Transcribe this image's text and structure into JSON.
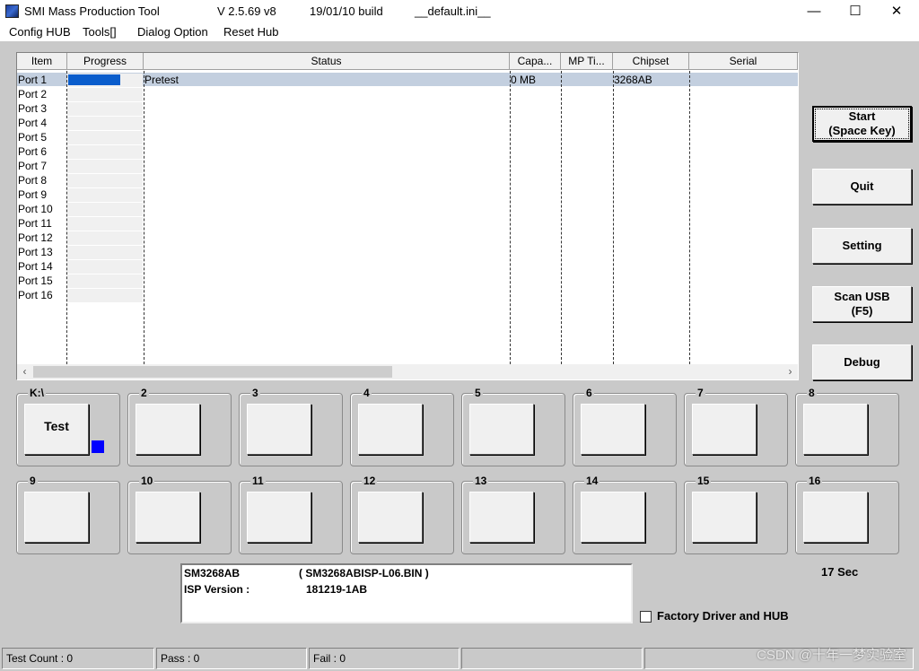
{
  "window": {
    "title": "SMI Mass Production Tool",
    "version": "V 2.5.69   v8",
    "build": "19/01/10 build",
    "ini": "__default.ini__",
    "controls": {
      "minimize": "—",
      "maximize": "☐",
      "close": "✕"
    }
  },
  "menu": [
    "Config HUB",
    "Tools[]",
    "Dialog Option",
    "Reset Hub"
  ],
  "grid": {
    "columns": [
      "Item",
      "Progress",
      "Status",
      "Capa...",
      "MP Ti...",
      "Chipset",
      "Serial"
    ],
    "rows": [
      {
        "item": "Port 1",
        "status": "Pretest",
        "capacity": "0 MB",
        "mp_time": "",
        "chipset": "3268AB",
        "serial": "",
        "progress": 0.7
      },
      {
        "item": "Port 2"
      },
      {
        "item": "Port 3"
      },
      {
        "item": "Port 4"
      },
      {
        "item": "Port 5"
      },
      {
        "item": "Port 6"
      },
      {
        "item": "Port 7"
      },
      {
        "item": "Port 8"
      },
      {
        "item": "Port 9"
      },
      {
        "item": "Port 10"
      },
      {
        "item": "Port 11"
      },
      {
        "item": "Port 12"
      },
      {
        "item": "Port 13"
      },
      {
        "item": "Port 14"
      },
      {
        "item": "Port 15"
      },
      {
        "item": "Port 16"
      }
    ],
    "scroll_left": "‹",
    "scroll_right": "›"
  },
  "buttons": {
    "start": "Start\n(Space Key)",
    "quit": "Quit",
    "setting": "Setting",
    "scan_usb": "Scan USB\n(F5)",
    "debug": "Debug"
  },
  "slots": [
    {
      "label": "K:\\",
      "button": "Test",
      "indicator": "#0000ff"
    },
    {
      "label": "2"
    },
    {
      "label": "3"
    },
    {
      "label": "4"
    },
    {
      "label": "5"
    },
    {
      "label": "6"
    },
    {
      "label": "7"
    },
    {
      "label": "8"
    },
    {
      "label": "9"
    },
    {
      "label": "10"
    },
    {
      "label": "11"
    },
    {
      "label": "12"
    },
    {
      "label": "13"
    },
    {
      "label": "14"
    },
    {
      "label": "15"
    },
    {
      "label": "16"
    }
  ],
  "info": {
    "chip": "SM3268AB",
    "bin": "( SM3268ABISP-L06.BIN )",
    "isp_label": "ISP Version :",
    "isp_value": "181219-1AB"
  },
  "timer": "17 Sec",
  "factory_checkbox": {
    "label": "Factory Driver and HUB",
    "checked": false
  },
  "statusbar": {
    "test_count": "Test Count : 0",
    "pass": "Pass : 0",
    "fail": "Fail : 0"
  },
  "watermark": "CSDN @十年一梦实验室"
}
